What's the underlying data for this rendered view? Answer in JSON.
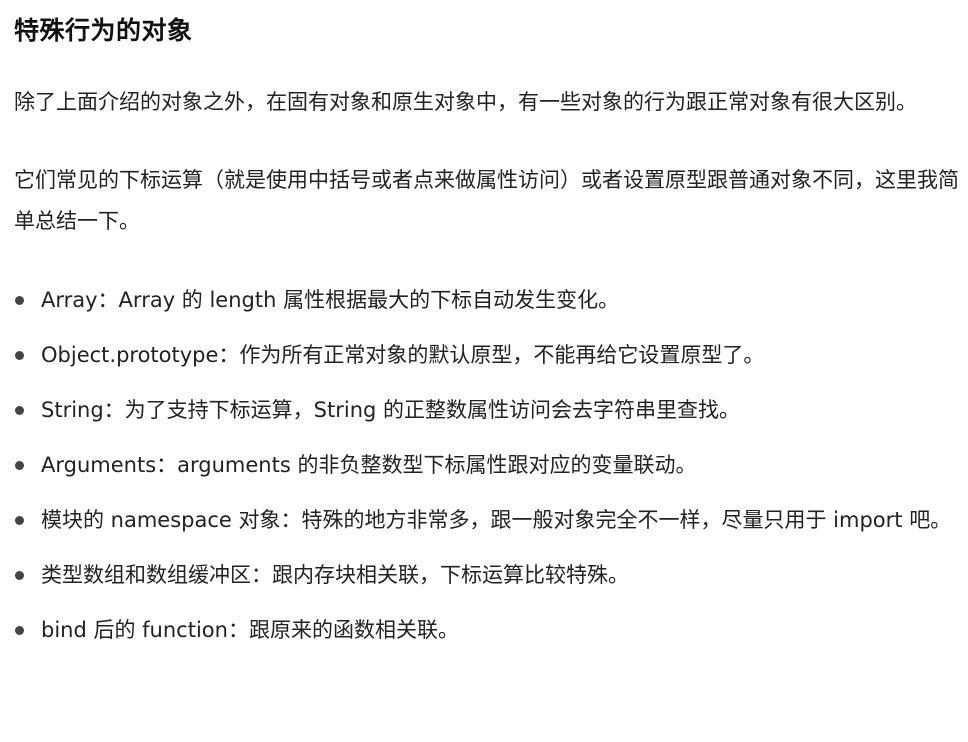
{
  "article": {
    "heading": "特殊行为的对象",
    "paragraphs": [
      "除了上面介绍的对象之外，在固有对象和原生对象中，有一些对象的行为跟正常对象有很大区别。",
      "它们常见的下标运算（就是使用中括号或者点来做属性访问）或者设置原型跟普通对象不同，这里我简单总结一下。"
    ],
    "bullets": [
      "Array：Array 的 length 属性根据最大的下标自动发生变化。",
      "Object.prototype：作为所有正常对象的默认原型，不能再给它设置原型了。",
      "String：为了支持下标运算，String 的正整数属性访问会去字符串里查找。",
      "Arguments：arguments 的非负整数型下标属性跟对应的变量联动。",
      "模块的 namespace 对象：特殊的地方非常多，跟一般对象完全不一样，尽量只用于 import 吧。",
      "类型数组和数组缓冲区：跟内存块相关联，下标运算比较特殊。",
      "bind 后的 function：跟原来的函数相关联。"
    ]
  }
}
